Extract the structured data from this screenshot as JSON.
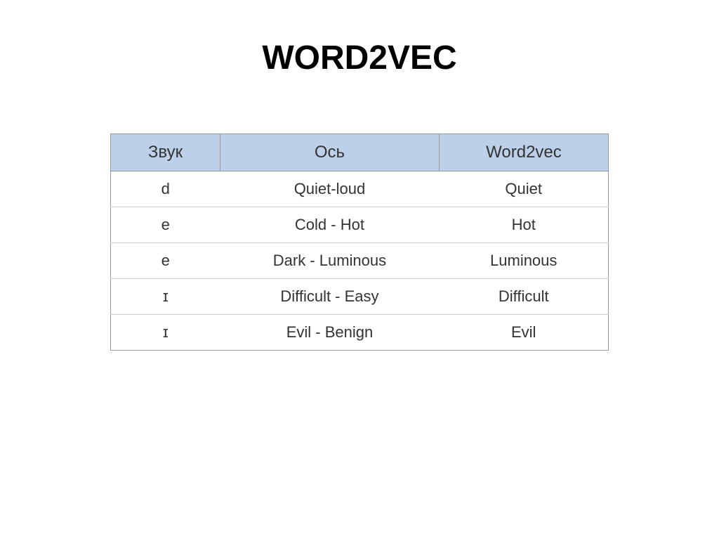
{
  "title": "WORD2VEC",
  "table": {
    "headers": [
      "Звук",
      "Ось",
      "Word2vec"
    ],
    "rows": [
      [
        "d",
        "Quiet-loud",
        "Quiet"
      ],
      [
        "e",
        "Cold - Hot",
        "Hot"
      ],
      [
        "e",
        "Dark - Luminous",
        "Luminous"
      ],
      [
        "ɪ",
        "Difficult - Easy",
        "Difficult"
      ],
      [
        "ɪ",
        "Evil - Benign",
        "Evil"
      ]
    ]
  }
}
